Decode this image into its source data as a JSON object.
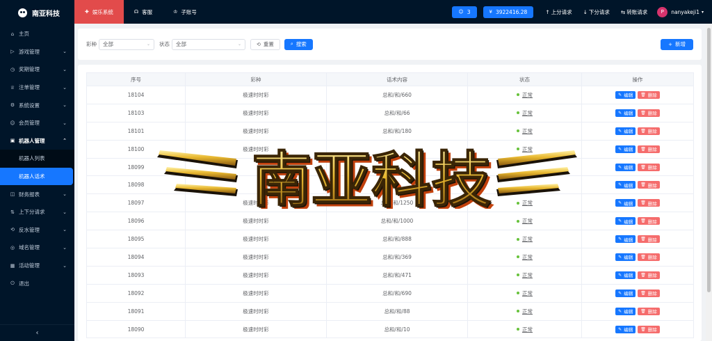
{
  "brand": {
    "name": "南亚科技"
  },
  "sidebar": {
    "items": [
      {
        "label": "主页",
        "icon": "home-icon",
        "glyph": "⌂",
        "arrow": ""
      },
      {
        "label": "游戏管理",
        "icon": "play-icon",
        "glyph": "▷",
        "arrow": "⌄"
      },
      {
        "label": "奖期管理",
        "icon": "clock-icon",
        "glyph": "◷",
        "arrow": "⌄"
      },
      {
        "label": "注单管理",
        "icon": "trophy-icon",
        "glyph": "♕",
        "arrow": "⌄"
      },
      {
        "label": "系统设置",
        "icon": "gear-icon",
        "glyph": "⚙",
        "arrow": "⌄"
      },
      {
        "label": "会员管理",
        "icon": "user-icon",
        "glyph": "☺",
        "arrow": "⌄"
      },
      {
        "label": "机器人管理",
        "icon": "robot-icon",
        "glyph": "▣",
        "arrow": "⌃"
      }
    ],
    "subitems": [
      {
        "label": "机器人列表"
      },
      {
        "label": "机器人话术"
      }
    ],
    "items_after": [
      {
        "label": "财务报表",
        "icon": "report-icon",
        "glyph": "◫",
        "arrow": "⌄"
      },
      {
        "label": "上下分请求",
        "icon": "transfer-icon",
        "glyph": "⇅",
        "arrow": "⌄"
      },
      {
        "label": "反水管理",
        "icon": "refund-icon",
        "glyph": "⟲",
        "arrow": "⌄"
      },
      {
        "label": "域名管理",
        "icon": "globe-icon",
        "glyph": "◎",
        "arrow": "⌄"
      },
      {
        "label": "活动管理",
        "icon": "calendar-icon",
        "glyph": "▦",
        "arrow": "⌄"
      },
      {
        "label": "退出",
        "icon": "logout-icon",
        "glyph": "⏻",
        "arrow": ""
      }
    ],
    "collapse_glyph": "‹"
  },
  "topbar": {
    "tabs": [
      {
        "label": "娱乐系统",
        "icon": "gift-icon",
        "glyph": "✚"
      },
      {
        "label": "客服",
        "icon": "headset-icon",
        "glyph": "☊"
      },
      {
        "label": "子账号",
        "icon": "accounts-icon",
        "glyph": "♔"
      }
    ],
    "online_count": "3",
    "balance": "3922416.28",
    "links": [
      {
        "label": "上分请求",
        "glyph": "↑",
        "icon": "arrow-up-icon"
      },
      {
        "label": "下分请求",
        "glyph": "↓",
        "icon": "arrow-down-icon"
      },
      {
        "label": "转账请求",
        "glyph": "⇆",
        "icon": "transfer-icon"
      }
    ],
    "avatar_letter": "P",
    "username": "nanyakeji1"
  },
  "filter": {
    "lottery_label": "彩种",
    "lottery_value": "全部",
    "status_label": "状态",
    "status_value": "全部",
    "reset_label": "重置",
    "search_label": "搜索",
    "add_label": "新增"
  },
  "table": {
    "headers": [
      "序号",
      "彩种",
      "话术内容",
      "状态",
      "操作"
    ],
    "edit_label": "编辑",
    "delete_label": "删除",
    "rows": [
      {
        "id": "18104",
        "lottery": "极速时时彩",
        "content": "总和/和/660",
        "status": "正常"
      },
      {
        "id": "18103",
        "lottery": "极速时时彩",
        "content": "总和/和/66",
        "status": "正常"
      },
      {
        "id": "18101",
        "lottery": "极速时时彩",
        "content": "总和/和/180",
        "status": "正常"
      },
      {
        "id": "18100",
        "lottery": "极速时时彩",
        "content": "",
        "status": "正常"
      },
      {
        "id": "18099",
        "lottery": "",
        "content": "",
        "status": ""
      },
      {
        "id": "18098",
        "lottery": "",
        "content": "",
        "status": ""
      },
      {
        "id": "18097",
        "lottery": "极速时时彩",
        "content": "总和/和/1250",
        "status": "正常"
      },
      {
        "id": "18096",
        "lottery": "极速时时彩",
        "content": "总和/和/1000",
        "status": "正常"
      },
      {
        "id": "18095",
        "lottery": "极速时时彩",
        "content": "总和/和/888",
        "status": "正常"
      },
      {
        "id": "18094",
        "lottery": "极速时时彩",
        "content": "总和/和/369",
        "status": "正常"
      },
      {
        "id": "18093",
        "lottery": "极速时时彩",
        "content": "总和/和/471",
        "status": "正常"
      },
      {
        "id": "18092",
        "lottery": "极速时时彩",
        "content": "总和/和/690",
        "status": "正常"
      },
      {
        "id": "18091",
        "lottery": "极速时时彩",
        "content": "总和/和/88",
        "status": "正常"
      },
      {
        "id": "18090",
        "lottery": "极速时时彩",
        "content": "总和/和/10",
        "status": "正常"
      }
    ]
  },
  "watermark": {
    "text": "南亚科技"
  }
}
